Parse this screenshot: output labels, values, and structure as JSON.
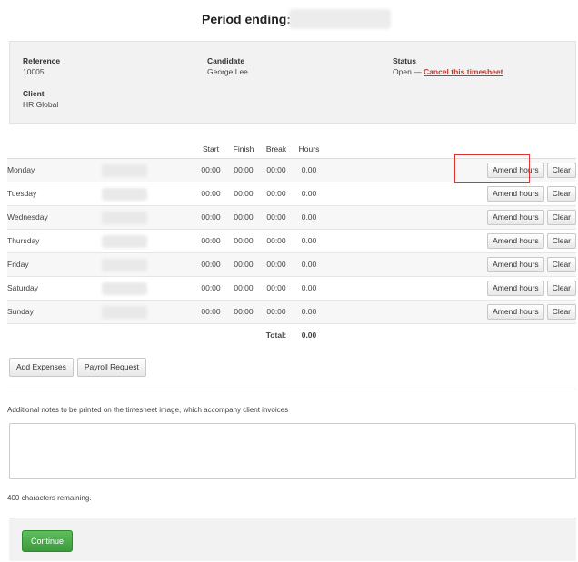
{
  "header": {
    "title": "Period ending:"
  },
  "info": {
    "reference_label": "Reference",
    "reference_value": "10005",
    "client_label": "Client",
    "client_value": "HR Global",
    "candidate_label": "Candidate",
    "candidate_value": "George Lee",
    "status_label": "Status",
    "status_value": "Open —",
    "cancel_link": "Cancel this timesheet"
  },
  "table": {
    "columns": [
      "Start",
      "Finish",
      "Break",
      "Hours"
    ],
    "rows": [
      {
        "day": "Monday",
        "start": "00:00",
        "finish": "00:00",
        "break": "00:00",
        "hours": "0.00"
      },
      {
        "day": "Tuesday",
        "start": "00:00",
        "finish": "00:00",
        "break": "00:00",
        "hours": "0.00"
      },
      {
        "day": "Wednesday",
        "start": "00:00",
        "finish": "00:00",
        "break": "00:00",
        "hours": "0.00"
      },
      {
        "day": "Thursday",
        "start": "00:00",
        "finish": "00:00",
        "break": "00:00",
        "hours": "0.00"
      },
      {
        "day": "Friday",
        "start": "00:00",
        "finish": "00:00",
        "break": "00:00",
        "hours": "0.00"
      },
      {
        "day": "Saturday",
        "start": "00:00",
        "finish": "00:00",
        "break": "00:00",
        "hours": "0.00"
      },
      {
        "day": "Sunday",
        "start": "00:00",
        "finish": "00:00",
        "break": "00:00",
        "hours": "0.00"
      }
    ],
    "amend_label": "Amend hours",
    "clear_label": "Clear",
    "total_label": "Total:",
    "total_value": "0.00"
  },
  "actions": {
    "add_expenses": "Add Expenses",
    "payroll_request": "Payroll Request"
  },
  "notes": {
    "label": "Additional notes to be printed on the timesheet image, which accompany client invoices",
    "value": "",
    "remaining": "400 characters remaining."
  },
  "footer": {
    "continue": "Continue"
  },
  "colors": {
    "highlight": "#e03131",
    "continue_green": "#4cae4c",
    "cancel_red": "#c0392b"
  }
}
